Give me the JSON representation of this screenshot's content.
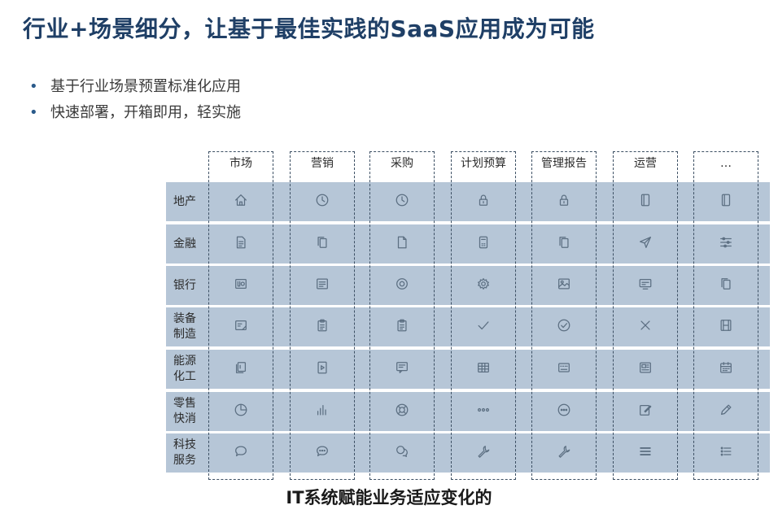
{
  "title": "行业+场景细分，让基于最佳实践的SaaS应用成为可能",
  "bullets": [
    "基于行业场景预置标准化应用",
    "快速部署，开箱即用，轻实施"
  ],
  "matrix": {
    "columns": [
      "市场",
      "营销",
      "采购",
      "计划预算",
      "管理报告",
      "运营",
      "…"
    ],
    "rows": [
      {
        "label": "地产",
        "icons": [
          "home-icon",
          "clock-icon",
          "clock-icon",
          "lock-icon",
          "lock-icon",
          "tablet-icon",
          "tablet-icon"
        ]
      },
      {
        "label": "金融",
        "icons": [
          "document-icon",
          "copy-icon",
          "file-icon",
          "calculator-icon",
          "copy-icon",
          "send-icon",
          "sliders-icon"
        ]
      },
      {
        "label": "银行",
        "icons": [
          "ui-icon",
          "list-icon",
          "settings-icon",
          "gear-icon",
          "image-icon",
          "monitor-icon",
          "copy-icon"
        ]
      },
      {
        "label": "装备\n制造",
        "icons": [
          "note-icon",
          "clipboard-icon",
          "clipboard-icon",
          "check-icon",
          "check-circle-icon",
          "close-icon",
          "film-icon"
        ]
      },
      {
        "label": "能源\n化工",
        "icons": [
          "layers-icon",
          "play-file-icon",
          "chat-doc-icon",
          "table-icon",
          "keyboard-icon",
          "newspaper-icon",
          "calendar-icon"
        ]
      },
      {
        "label": "零售\n快消",
        "icons": [
          "pie-icon",
          "bar-chart-icon",
          "lifebuoy-icon",
          "more-icon",
          "more-circle-icon",
          "edit-icon",
          "pen-icon"
        ]
      },
      {
        "label": "科技\n服务",
        "icons": [
          "speech-icon",
          "chat-dots-icon",
          "chat-icon",
          "wrench-icon",
          "wrench-icon",
          "menu-icon",
          "list-bullets-icon"
        ]
      }
    ]
  },
  "caption": "IT系统赋能业务适应变化的"
}
